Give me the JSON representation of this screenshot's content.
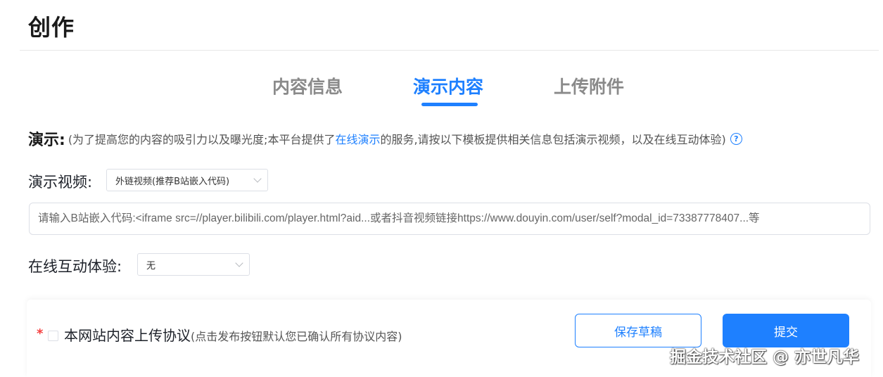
{
  "header": {
    "title": "创作"
  },
  "tabs": [
    {
      "label": "内容信息",
      "active": false
    },
    {
      "label": "演示内容",
      "active": true
    },
    {
      "label": "上传附件",
      "active": false
    }
  ],
  "intro": {
    "label": "演示:",
    "text_before": "(为了提高您的内容的吸引力以及曝光度;本平台提供了",
    "link": "在线演示",
    "text_after": "的服务,请按以下模板提供相关信息包括演示视频，以及在线互动体验)",
    "help_icon": "question-circle-icon"
  },
  "video": {
    "label": "演示视频:",
    "select_value": "外链视频(推荐B站嵌入代码)",
    "input_placeholder": "请输入B站嵌入代码:<iframe src=//player.bilibili.com/player.html?aid...或者抖音视频链接https://www.douyin.com/user/self?modal_id=73387778407...等",
    "input_value": ""
  },
  "interactive": {
    "label": "在线互动体验:",
    "select_value": "无"
  },
  "footer": {
    "required_mark": "*",
    "agreement_main": "本网站内容上传协议",
    "agreement_note": "(点击发布按钮默认您已确认所有协议内容)",
    "save_draft_label": "保存草稿",
    "submit_label": "提交"
  },
  "watermark": "掘金技术社区 @ 亦世凡华",
  "colors": {
    "accent": "#1e80ff",
    "required": "#f53f3f",
    "inactive_tab": "#8a8a8a"
  }
}
